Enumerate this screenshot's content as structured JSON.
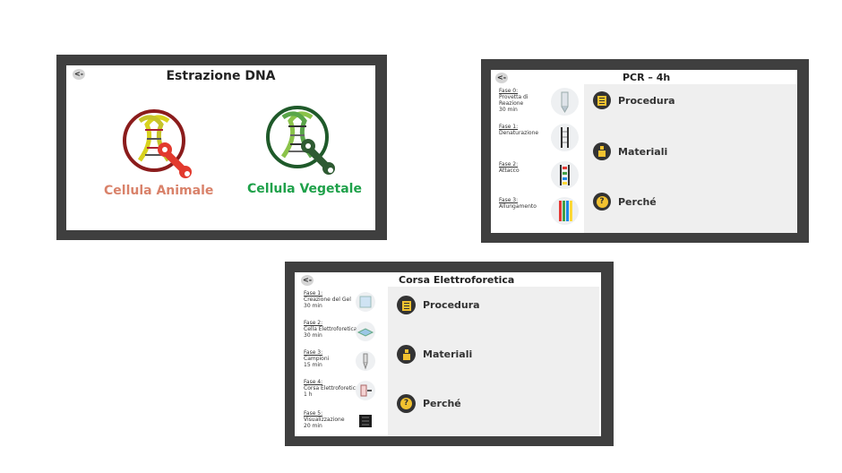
{
  "estrazione": {
    "back_label": "<-",
    "title": "Estrazione DNA",
    "animal_label": "Cellula Animale",
    "vegetal_label": "Cellula Vegetale",
    "animal_color": "#d9826a",
    "vegetal_color": "#1fa14a",
    "animal_ring": "#8b1c1c",
    "vegetal_ring": "#1f5a2a",
    "animal_icon": "dna-wrench-icon",
    "vegetal_icon": "dna-wrench-icon"
  },
  "pcr": {
    "back_label": "<-",
    "title": "PCR –  4h",
    "steps": [
      {
        "fase": "Fase 0:",
        "desc": "Provetta di",
        "desc2": "Reazione",
        "time": "30 min",
        "icon": "tube-icon"
      },
      {
        "fase": "Fase 1:",
        "desc": "Denaturazione",
        "desc2": "",
        "time": "",
        "icon": "denaturation-icon"
      },
      {
        "fase": "Fase 2:",
        "desc": "Attacco",
        "desc2": "",
        "time": "",
        "icon": "annealing-icon"
      },
      {
        "fase": "Fase 3:",
        "desc": "Allungamento",
        "desc2": "",
        "time": "",
        "icon": "extension-icon"
      }
    ],
    "menu": [
      {
        "label": "Procedura",
        "icon": "clipboard-icon"
      },
      {
        "label": "Materiali",
        "icon": "flask-icon"
      },
      {
        "label": "Perché",
        "icon": "question-icon"
      }
    ]
  },
  "corsa": {
    "back_label": "<-",
    "title": "Corsa Elettroforetica",
    "steps": [
      {
        "fase": "Fase 1:",
        "desc": "Creazione del Gel",
        "time": "30 min",
        "icon": "gel-icon"
      },
      {
        "fase": "Fase 2:",
        "desc": "Cella Elettroforetica",
        "time": "30 min",
        "icon": "cell-icon"
      },
      {
        "fase": "Fase 3:",
        "desc": "Campioni",
        "time": "15 min",
        "icon": "pipette-icon"
      },
      {
        "fase": "Fase 4:",
        "desc": "Corsa Elettroforetica",
        "time": "1 h",
        "icon": "run-icon"
      },
      {
        "fase": "Fase 5:",
        "desc": "Visualizzazione",
        "time": "20 min",
        "icon": "visual-icon"
      }
    ],
    "menu": [
      {
        "label": "Procedura",
        "icon": "clipboard-icon"
      },
      {
        "label": "Materiali",
        "icon": "flask-icon"
      },
      {
        "label": "Perché",
        "icon": "question-icon"
      }
    ]
  }
}
